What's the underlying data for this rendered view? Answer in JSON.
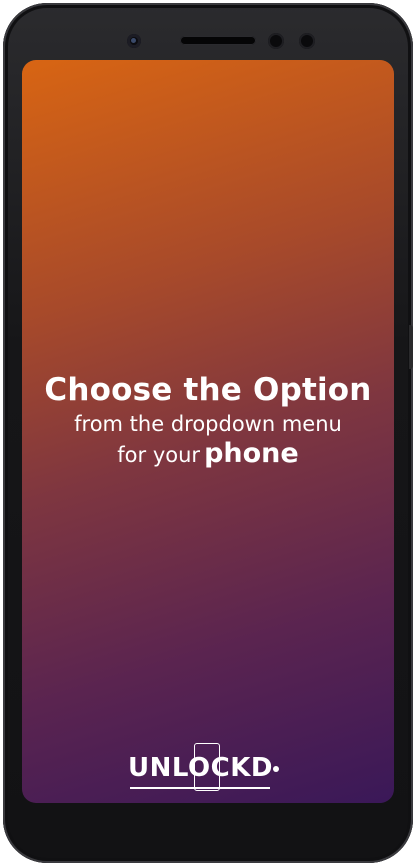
{
  "screen": {
    "headline": "Choose the Option",
    "line2": "from the dropdown menu",
    "line3_prefix": "for your",
    "line3_emphasis": "phone"
  },
  "logo": {
    "text": "UNLOCKD"
  },
  "colors": {
    "gradient_top": "#d86513",
    "gradient_bottom": "#3a1858",
    "text": "#ffffff",
    "phone_body": "#161618"
  },
  "icons": [
    "front-camera-icon",
    "earpiece-speaker-icon",
    "sensor-icon"
  ]
}
